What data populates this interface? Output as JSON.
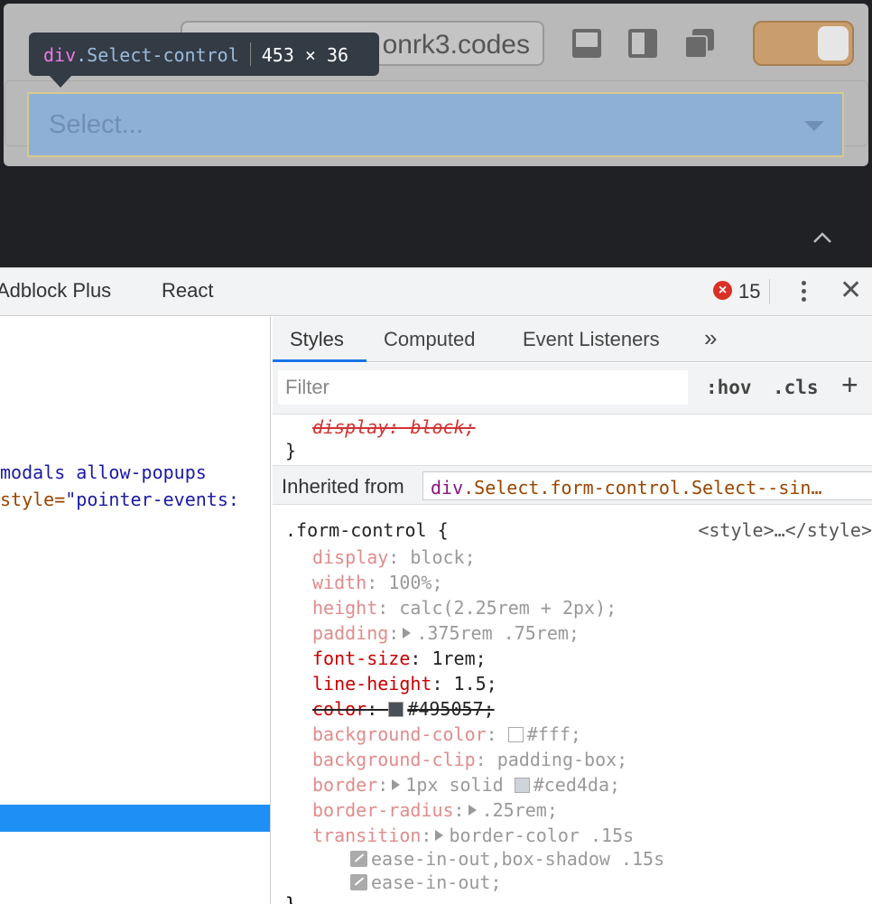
{
  "preview": {
    "url_partial": "onrk3.codes",
    "select_placeholder": "Select...",
    "tooltip": {
      "tag": "div",
      "class": ".Select-control",
      "size": "453 × 36"
    },
    "theme_toggle_color": "#c99e6c"
  },
  "devtools": {
    "main_tabs": [
      "Adblock Plus",
      "React"
    ],
    "error_count": "15",
    "elements_lines": [
      {
        "text_a": "modals allow-popups",
        "text_b": ""
      },
      {
        "text_a": "style=",
        "text_b": "\"pointer-events:"
      }
    ],
    "sub_tabs": [
      "Styles",
      "Computed",
      "Event Listeners",
      "»"
    ],
    "filter_placeholder": "Filter",
    "hov_label": ":hov",
    "cls_label": ".cls",
    "plus_label": "+",
    "previous_rule_tail": "display: block;",
    "close_brace": "}",
    "inherited_label": "Inherited from",
    "inherited_tag": "div",
    "inherited_classes": ".Select.form-control.Select--sin…",
    "selector": ".form-control {",
    "source": "<style>…</style>",
    "declarations": [
      {
        "prop": "display",
        "value": "block;"
      },
      {
        "prop": "width",
        "value": "100%;"
      },
      {
        "prop": "height",
        "value": "calc(2.25rem + 2px);"
      },
      {
        "prop": "padding",
        "value": ".375rem .75rem;"
      },
      {
        "prop": "font-size",
        "value": "1rem;"
      },
      {
        "prop": "line-height",
        "value": "1.5;"
      },
      {
        "prop": "color",
        "value": "#495057;",
        "swatch": "#495057"
      },
      {
        "prop": "background-color",
        "value": "#fff;",
        "swatch": "#ffffff"
      },
      {
        "prop": "background-clip",
        "value": "padding-box;"
      },
      {
        "prop": "border",
        "value_a": "1px solid",
        "value": "#ced4da;",
        "swatch": "#ced4da"
      },
      {
        "prop": "border-radius",
        "value": ".25rem;"
      },
      {
        "prop": "transition",
        "value": "border-color .15s"
      }
    ],
    "transition_cont": [
      "ease-in-out,box-shadow .15s",
      "ease-in-out;"
    ]
  }
}
